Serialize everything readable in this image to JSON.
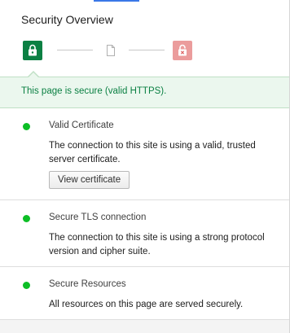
{
  "panel": {
    "title": "Security Overview"
  },
  "security_states": [
    {
      "state": "secure",
      "icon": "lock-closed-icon",
      "color": "#0b8043"
    },
    {
      "state": "neutral",
      "icon": "document-icon",
      "color": "#b0b0b0"
    },
    {
      "state": "insecure",
      "icon": "lock-broken-icon",
      "color": "#eb9c9c"
    }
  ],
  "summary": {
    "text": "This page is secure (valid HTTPS).",
    "color": "#0b8043",
    "background": "#ebf7ee"
  },
  "sections": [
    {
      "title": "Valid Certificate",
      "description": "The connection to this site is using a valid, trusted server certificate.",
      "button_label": "View certificate",
      "status_color": "#0dbe26"
    },
    {
      "title": "Secure TLS connection",
      "description": "The connection to this site is using a strong protocol version and cipher suite.",
      "status_color": "#0dbe26"
    },
    {
      "title": "Secure Resources",
      "description": "All resources on this page are served securely.",
      "status_color": "#0dbe26"
    }
  ]
}
